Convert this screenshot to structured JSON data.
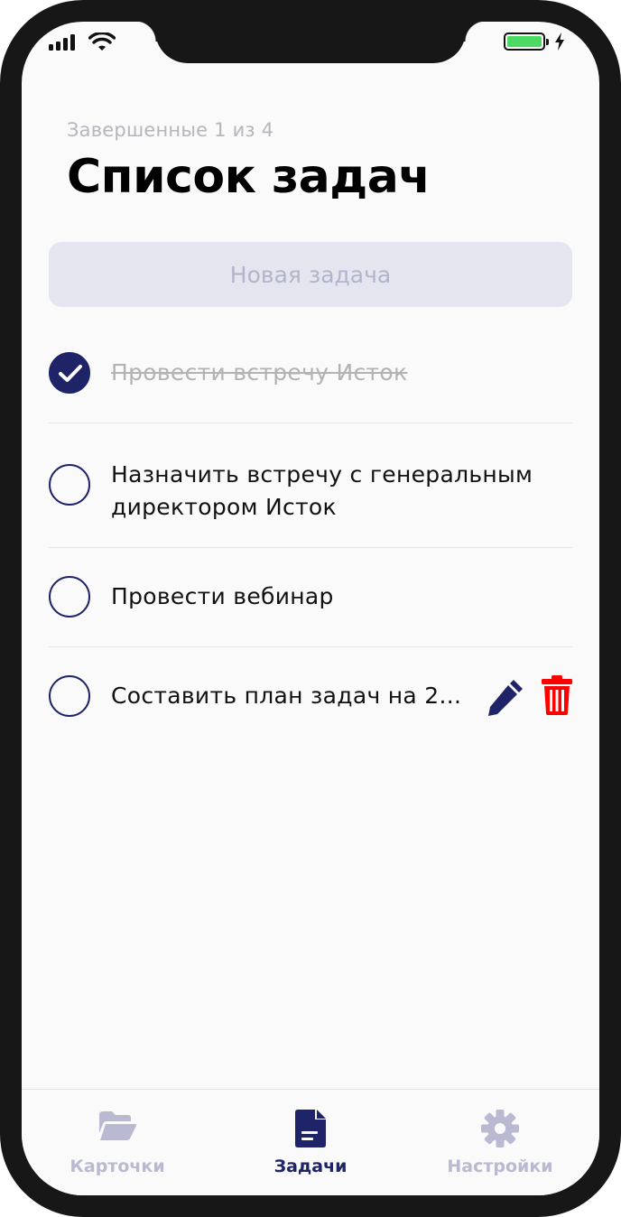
{
  "header": {
    "subtitle": "Завершенные 1 из 4",
    "title": "Список задач"
  },
  "new_task": {
    "placeholder": "Новая задача"
  },
  "tasks": [
    {
      "text": "Провести встречу Исток",
      "completed": true
    },
    {
      "line1": "Назначить встречу с генеральным",
      "line2": "директором Исток",
      "completed": false
    },
    {
      "text": "Провести вебинар",
      "completed": false
    },
    {
      "text": "Составить план задач на 2...",
      "completed": false
    }
  ],
  "tabs": [
    {
      "label": "Карточки",
      "icon": "folder-open-icon",
      "active": false
    },
    {
      "label": "Задачи",
      "icon": "document-icon",
      "active": true
    },
    {
      "label": "Настройки",
      "icon": "gear-icon",
      "active": false
    }
  ],
  "colors": {
    "primary": "#1f2469",
    "danger": "#ff0000",
    "inactive_tab": "#b9bad2",
    "battery": "#4cd964"
  }
}
